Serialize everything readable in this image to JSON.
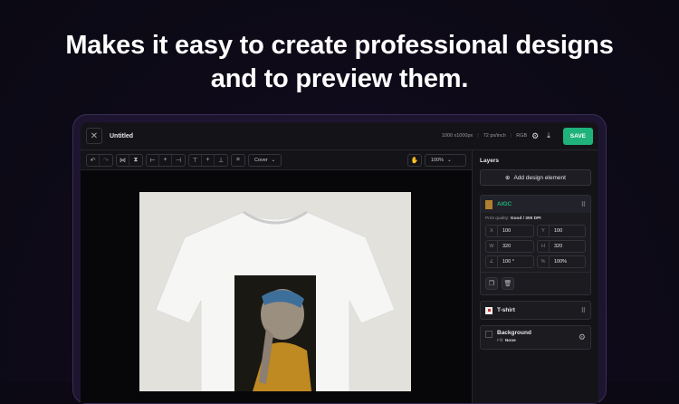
{
  "headline": {
    "line1": "Makes it easy to create professional designs",
    "line2": "and to preview them."
  },
  "header": {
    "title": "Untitled",
    "size": "1000 x1000px",
    "resolution": "72 px/inch",
    "color_mode": "RGB",
    "save": "SAVE"
  },
  "toolbar": {
    "fit_mode": "Cover",
    "zoom": "100%"
  },
  "layers": {
    "title": "Layers",
    "add_button": "Add design element",
    "aigc": {
      "name": "AIGC",
      "print_quality_label": "Print quality:",
      "print_quality_value": "Good / 300 DPI",
      "x_label": "X",
      "x": "100",
      "y_label": "Y",
      "y": "100",
      "w_label": "W",
      "w": "320",
      "h_label": "H",
      "h": "320",
      "rotation": "100 °",
      "opacity": "100%"
    },
    "tshirt": {
      "name": "T-shirt"
    },
    "background": {
      "name": "Background",
      "fill_label": "Fill:",
      "fill_value": "None"
    }
  },
  "colors": {
    "accent": "#1fb27a"
  }
}
